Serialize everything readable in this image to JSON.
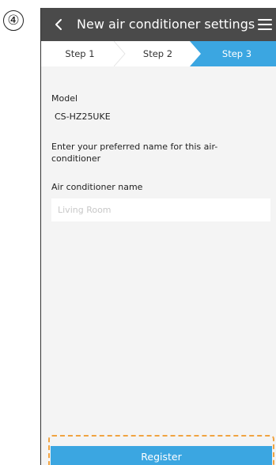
{
  "step_marker": "④",
  "header": {
    "title": "New air conditioner settings",
    "back_icon": "chevron-left-icon",
    "menu_icon": "hamburger-menu-icon"
  },
  "steps": [
    {
      "label": "Step 1",
      "active": false
    },
    {
      "label": "Step 2",
      "active": false
    },
    {
      "label": "Step 3",
      "active": true
    }
  ],
  "form": {
    "model_label": "Model",
    "model_value": "CS-HZ25UKE",
    "instruction_line1": "Enter your preferred name for this air-",
    "instruction_line2": "conditioner",
    "name_label": "Air conditioner name",
    "name_placeholder": "Living Room",
    "name_value": ""
  },
  "register_label": "Register",
  "colors": {
    "header_bg": "#4a4a4a",
    "accent": "#3ba6e1",
    "highlight": "#f0a340",
    "page_bg": "#f4f4f4"
  }
}
